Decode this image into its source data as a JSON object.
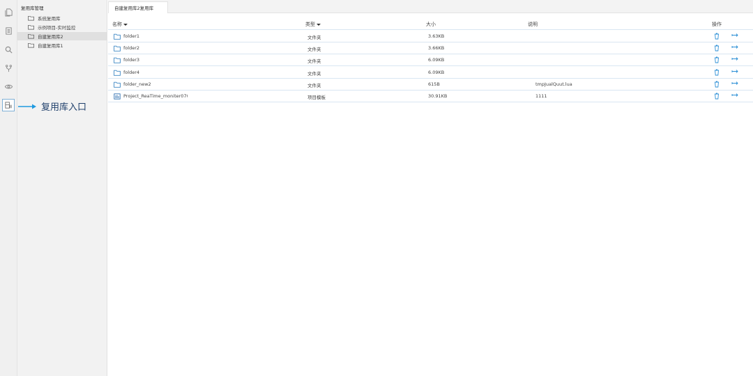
{
  "sidebar": {
    "title": "复用库管理",
    "items": [
      {
        "label": "系统复用库"
      },
      {
        "label": "示例项目-实时监控"
      },
      {
        "label": "自建复用库2"
      },
      {
        "label": "自建复用库1"
      }
    ]
  },
  "annotation": {
    "label": "复用库入口"
  },
  "tab": {
    "label": "自建复用库2复用库"
  },
  "table": {
    "headers": {
      "name": "名称",
      "type": "类型",
      "size": "大小",
      "desc": "说明",
      "ops": "操作"
    },
    "rows": [
      {
        "name": "folder1",
        "type": "文件夹",
        "size": "3.63KB",
        "desc": "",
        "icon": "folder-icon"
      },
      {
        "name": "folder2",
        "type": "文件夹",
        "size": "3.66KB",
        "desc": "",
        "icon": "folder-icon"
      },
      {
        "name": "folder3",
        "type": "文件夹",
        "size": "6.09KB",
        "desc": "",
        "icon": "folder-icon"
      },
      {
        "name": "folder4",
        "type": "文件夹",
        "size": "6.09KB",
        "desc": "",
        "icon": "folder-icon"
      },
      {
        "name": "folder_new2",
        "type": "文件夹",
        "size": "615B",
        "desc": "tmpJualQuut.lua",
        "icon": "folder-icon"
      },
      {
        "name": "Project_ReaTime_moniter070",
        "type": "项目模板",
        "size": "30.91KB",
        "desc": "1111",
        "icon": "template-icon"
      }
    ]
  },
  "colors": {
    "accent": "#2b8fd6",
    "arrow": "#1f9ae0",
    "annotation_text": "#1f3f6b"
  }
}
